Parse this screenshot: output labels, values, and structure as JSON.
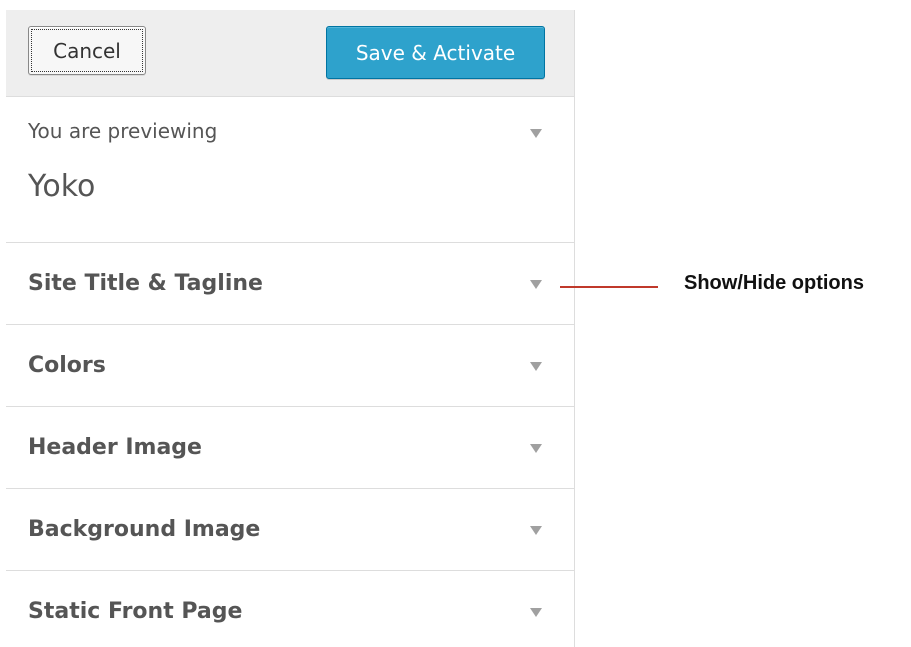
{
  "header": {
    "cancel_label": "Cancel",
    "save_label": "Save & Activate"
  },
  "preview": {
    "label": "You are previewing",
    "theme_name": "Yoko"
  },
  "sections": [
    {
      "title": "Site Title & Tagline"
    },
    {
      "title": "Colors"
    },
    {
      "title": "Header Image"
    },
    {
      "title": "Background Image"
    },
    {
      "title": "Static Front Page"
    }
  ],
  "annotation": {
    "text": "Show/Hide options"
  },
  "colors": {
    "primary_button": "#2ea2cc",
    "annotation_line": "#c0392b"
  },
  "icons": {
    "section_toggle": "triangle-down-icon"
  }
}
